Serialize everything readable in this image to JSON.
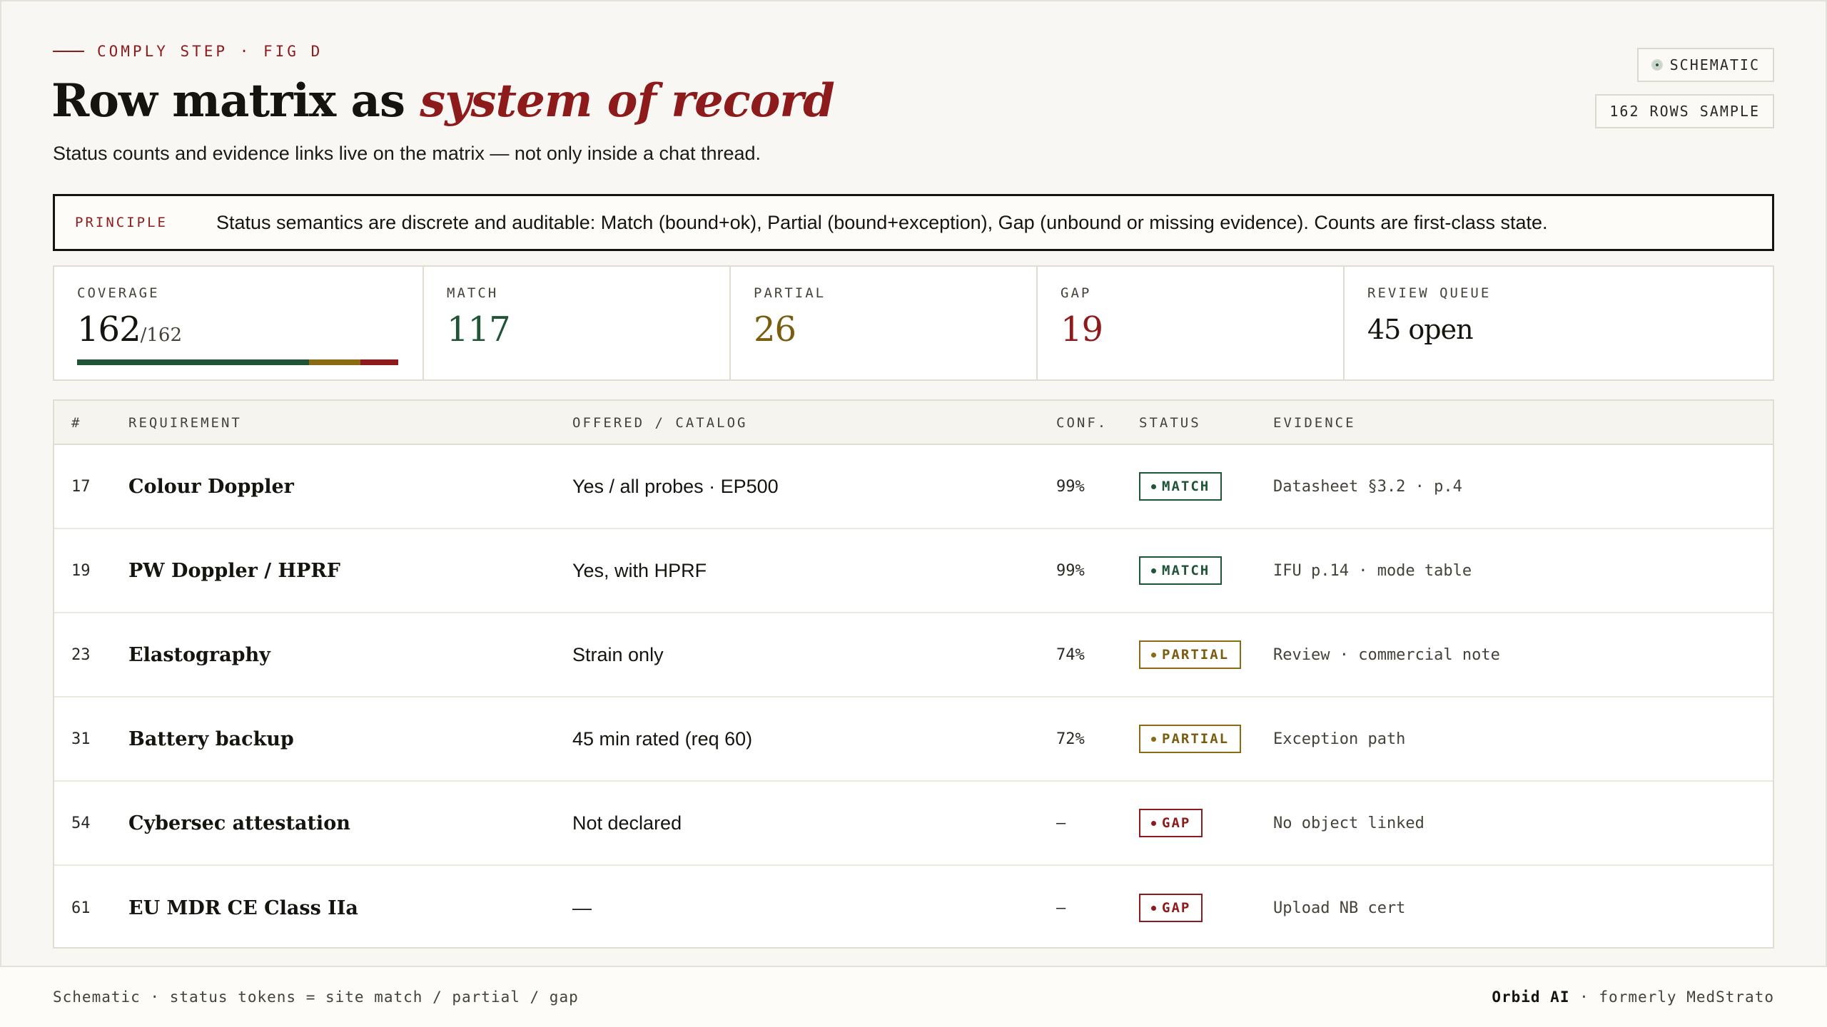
{
  "header": {
    "eyebrow": "COMPLY STEP · FIG D",
    "title_prefix": "Row matrix as ",
    "title_accent": "system of record",
    "subtitle": "Status counts and evidence links live on the matrix — not only inside a chat thread.",
    "chip_schematic": "SCHEMATIC",
    "chip_rows": "162 ROWS SAMPLE"
  },
  "principle": {
    "tag": "PRINCIPLE",
    "text": "Status semantics are discrete and auditable: Match (bound+ok), Partial (bound+exception), Gap (unbound or missing evidence). Counts are first-class state."
  },
  "stats": {
    "coverage_label": "COVERAGE",
    "coverage_value": "162",
    "coverage_total": "/162",
    "match_label": "MATCH",
    "match_value": "117",
    "partial_label": "PARTIAL",
    "partial_value": "26",
    "gap_label": "GAP",
    "gap_value": "19",
    "queue_label": "REVIEW QUEUE",
    "queue_value": "45 open",
    "coverage_bar": [
      {
        "status": "match",
        "count": 117
      },
      {
        "status": "partial",
        "count": 26
      },
      {
        "status": "gap",
        "count": 19
      }
    ]
  },
  "colors": {
    "match": "#1f5536",
    "partial": "#8a6a12",
    "gap": "#8e1b1b",
    "match_text": "#1f5536",
    "partial_text": "#7a5c0e",
    "gap_text": "#8e1b1b",
    "accent": "#8e1b1b"
  },
  "table": {
    "headers": {
      "num": "#",
      "requirement": "REQUIREMENT",
      "offered": "OFFERED / CATALOG",
      "conf": "CONF.",
      "status": "STATUS",
      "evidence": "EVIDENCE"
    },
    "rows": [
      {
        "num": "17",
        "requirement": "Colour Doppler",
        "offered": "Yes / all probes · EP500",
        "conf": "99%",
        "status": "MATCH",
        "status_key": "match",
        "evidence": "Datasheet §3.2 · p.4"
      },
      {
        "num": "19",
        "requirement": "PW Doppler / HPRF",
        "offered": "Yes, with HPRF",
        "conf": "99%",
        "status": "MATCH",
        "status_key": "match",
        "evidence": "IFU p.14 · mode table"
      },
      {
        "num": "23",
        "requirement": "Elastography",
        "offered": "Strain only",
        "conf": "74%",
        "status": "PARTIAL",
        "status_key": "partial",
        "evidence": "Review · commercial note"
      },
      {
        "num": "31",
        "requirement": "Battery backup",
        "offered": "45 min rated (req 60)",
        "conf": "72%",
        "status": "PARTIAL",
        "status_key": "partial",
        "evidence": "Exception path"
      },
      {
        "num": "54",
        "requirement": "Cybersec attestation",
        "offered": "Not declared",
        "conf": "—",
        "status": "GAP",
        "status_key": "gap",
        "evidence": "No object linked"
      },
      {
        "num": "61",
        "requirement": "EU MDR CE Class IIa",
        "offered": "—",
        "conf": "—",
        "status": "GAP",
        "status_key": "gap",
        "evidence": "Upload NB cert"
      }
    ]
  },
  "footer": {
    "left": "Schematic · status tokens = site match / partial / gap",
    "brand": "Orbid AI",
    "right_suffix": " · formerly MedStrato"
  }
}
